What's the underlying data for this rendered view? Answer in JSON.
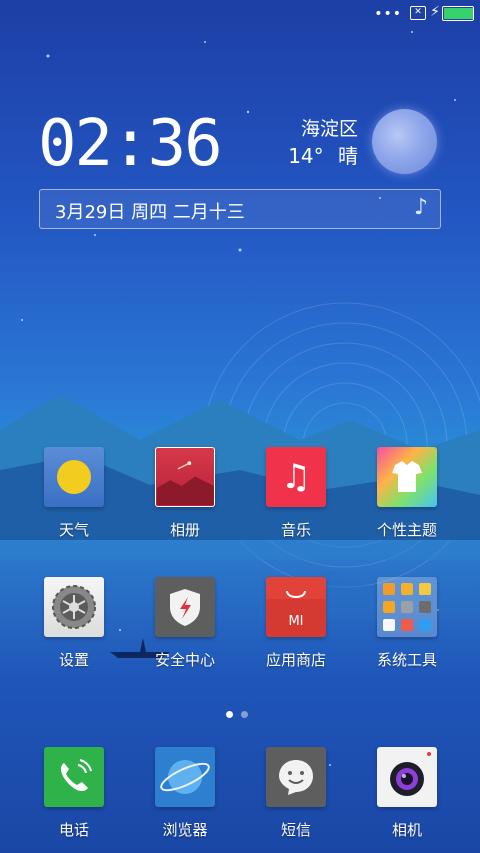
{
  "status": {
    "dots": "•••",
    "sim_icon": "sim-missing-icon",
    "charging_icon": "charging-bolt-icon",
    "battery_level": 0.95
  },
  "clock": {
    "time": "02:36"
  },
  "weather": {
    "location": "海淀区",
    "temp": "14°",
    "condition": "晴"
  },
  "datebar": {
    "date": "3月29日 周四 二月十三",
    "icon": "music-note-icon"
  },
  "apps": [
    {
      "label": "天气",
      "icon": "weather-sun-icon"
    },
    {
      "label": "相册",
      "icon": "gallery-icon"
    },
    {
      "label": "音乐",
      "icon": "music-icon"
    },
    {
      "label": "个性主题",
      "icon": "themes-icon"
    },
    {
      "label": "设置",
      "icon": "settings-gear-icon"
    },
    {
      "label": "安全中心",
      "icon": "security-shield-icon"
    },
    {
      "label": "应用商店",
      "icon": "app-store-bag-icon"
    },
    {
      "label": "系统工具",
      "icon": "tools-folder-icon"
    }
  ],
  "pager": {
    "pages": 2,
    "current": 1
  },
  "dock": [
    {
      "label": "电话",
      "icon": "phone-icon"
    },
    {
      "label": "浏览器",
      "icon": "browser-icon"
    },
    {
      "label": "短信",
      "icon": "messages-icon"
    },
    {
      "label": "相机",
      "icon": "camera-icon"
    }
  ],
  "colors": {
    "battery": "#37d26b",
    "sun": "#f2cd1f",
    "music": "#f0334a",
    "phone": "#2fb24a",
    "browser": "#2f7fd0",
    "camera_accent": "#e53a3a"
  }
}
